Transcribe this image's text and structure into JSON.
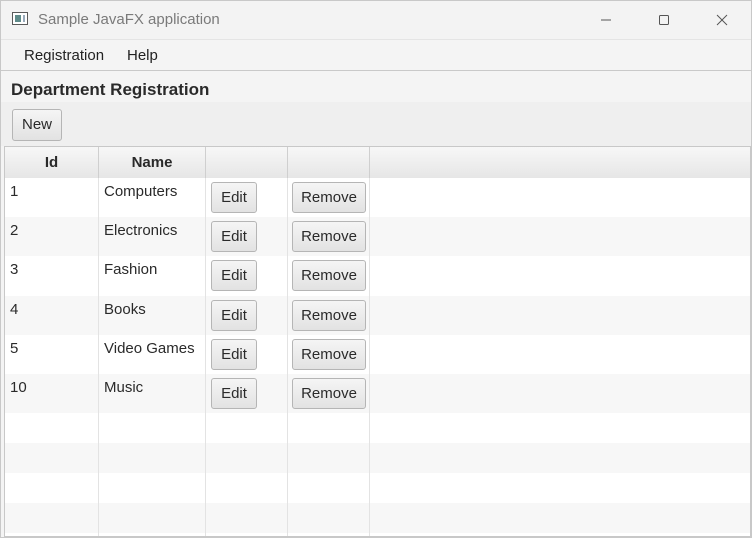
{
  "window": {
    "title": "Sample JavaFX application"
  },
  "menu": {
    "items": [
      "Registration",
      "Help"
    ]
  },
  "page": {
    "title": "Department Registration",
    "new_label": "New"
  },
  "table": {
    "columns": [
      "Id",
      "Name",
      "",
      ""
    ],
    "edit_label": "Edit",
    "remove_label": "Remove",
    "rows": [
      {
        "id": "1",
        "name": "Computers"
      },
      {
        "id": "2",
        "name": "Electronics"
      },
      {
        "id": "3",
        "name": "Fashion"
      },
      {
        "id": "4",
        "name": "Books"
      },
      {
        "id": "5",
        "name": "Video Games"
      },
      {
        "id": "10",
        "name": "Music"
      }
    ]
  },
  "icons": {
    "app": "app-window-icon",
    "minimize": "minimize-icon",
    "maximize": "maximize-icon",
    "close": "close-icon"
  }
}
